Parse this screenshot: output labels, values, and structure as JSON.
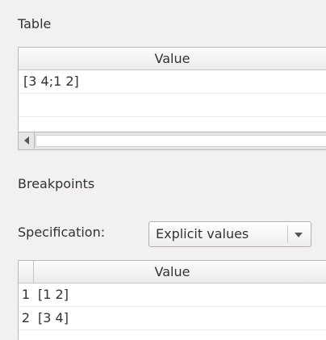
{
  "table_section": {
    "label": "Table",
    "column_header": "Value",
    "rows": [
      "[3 4;1 2]"
    ]
  },
  "breakpoints_section": {
    "label": "Breakpoints",
    "specification_label": "Specification:",
    "specification_value": "Explicit values",
    "column_header": "Value",
    "rows": [
      {
        "index": "1",
        "value": "[1 2]"
      },
      {
        "index": "2",
        "value": "[3 4]"
      }
    ]
  },
  "icons": {
    "scroll_left": "left-arrow-icon",
    "dropdown": "chevron-down-icon"
  },
  "colors": {
    "background": "#f2f1f0",
    "table_background": "#ffffff",
    "border": "#b8b8b8",
    "text": "#2e3436"
  }
}
